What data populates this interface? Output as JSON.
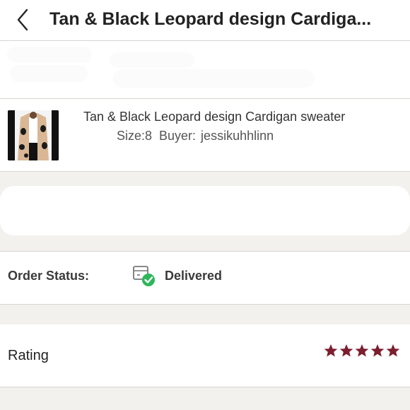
{
  "header": {
    "title": "Tan & Black Leopard design Cardiga..."
  },
  "item": {
    "title": "Tan & Black Leopard design Cardigan sweater",
    "size": "Size:8",
    "buyer": "Buyer: jessikuhhlinn"
  },
  "order_status": {
    "label": "Order Status:",
    "value": "Delivered",
    "icon": "package-delivered-icon",
    "icon_color": "#2fb55a"
  },
  "rating": {
    "label": "Rating",
    "stars": 5,
    "max_stars": 5,
    "star_color": "#7c1e2e"
  }
}
